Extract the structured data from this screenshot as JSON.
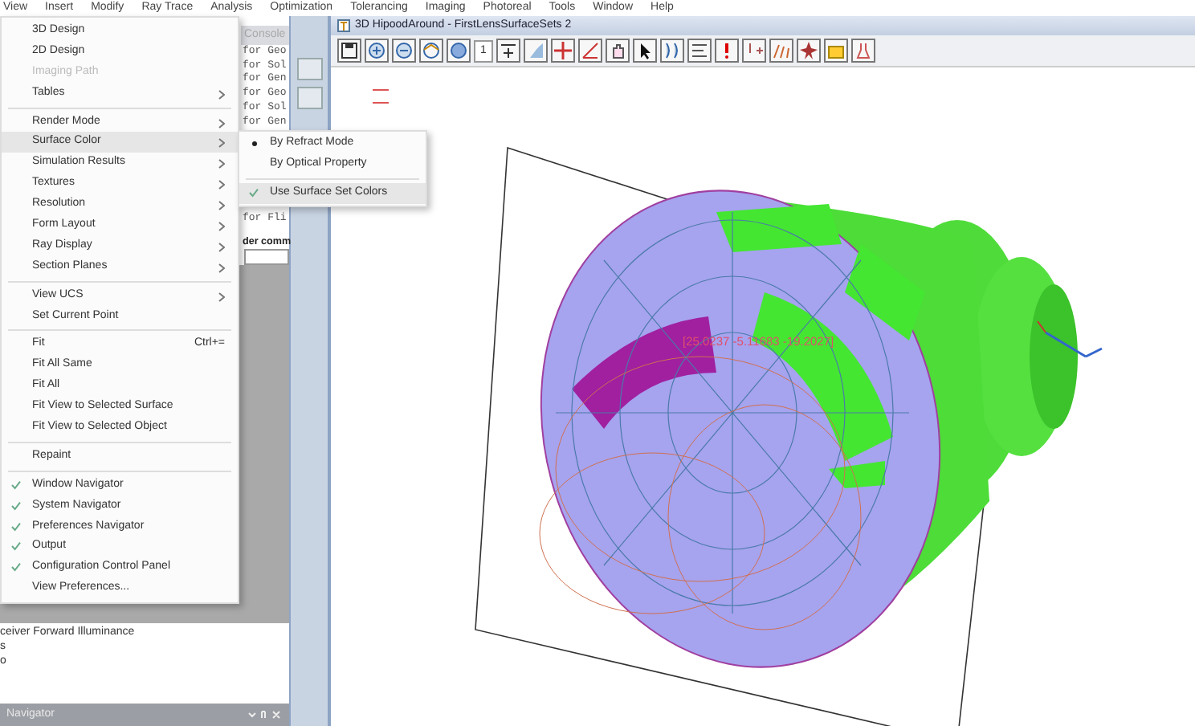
{
  "menu_bar": [
    "View",
    "Insert",
    "Modify",
    "Ray Trace",
    "Analysis",
    "Optimization",
    "Tolerancing",
    "Imaging",
    "Photoreal",
    "Tools",
    "Window",
    "Help"
  ],
  "view_menu": [
    {
      "kind": "item",
      "label": "3D Design"
    },
    {
      "kind": "item",
      "label": "2D Design"
    },
    {
      "kind": "item",
      "label": "Imaging Path",
      "disabled": true
    },
    {
      "kind": "item",
      "label": "Tables",
      "submenu": true
    },
    {
      "kind": "separator"
    },
    {
      "kind": "item",
      "label": "Render Mode",
      "submenu": true
    },
    {
      "kind": "item",
      "label": "Surface Color",
      "submenu": true,
      "selected": true
    },
    {
      "kind": "item",
      "label": "Simulation Results",
      "submenu": true
    },
    {
      "kind": "item",
      "label": "Textures",
      "submenu": true
    },
    {
      "kind": "item",
      "label": "Resolution",
      "submenu": true
    },
    {
      "kind": "item",
      "label": "Form Layout",
      "submenu": true
    },
    {
      "kind": "item",
      "label": "Ray Display",
      "submenu": true
    },
    {
      "kind": "item",
      "label": "Section Planes",
      "submenu": true
    },
    {
      "kind": "separator"
    },
    {
      "kind": "item",
      "label": "View UCS",
      "submenu": true
    },
    {
      "kind": "item",
      "label": "Set Current Point"
    },
    {
      "kind": "separator"
    },
    {
      "kind": "item",
      "label": "Fit",
      "shortcut": "Ctrl+="
    },
    {
      "kind": "item",
      "label": "Fit All Same"
    },
    {
      "kind": "item",
      "label": "Fit All"
    },
    {
      "kind": "item",
      "label": "Fit View to Selected Surface"
    },
    {
      "kind": "item",
      "label": "Fit View to Selected Object"
    },
    {
      "kind": "separator"
    },
    {
      "kind": "item",
      "label": "Repaint"
    },
    {
      "kind": "separator"
    },
    {
      "kind": "item",
      "label": "Window Navigator",
      "checked": true
    },
    {
      "kind": "item",
      "label": "System Navigator",
      "checked": true
    },
    {
      "kind": "item",
      "label": "Preferences Navigator",
      "checked": true
    },
    {
      "kind": "item",
      "label": "Output",
      "checked": true
    },
    {
      "kind": "item",
      "label": "Configuration Control Panel",
      "checked": true
    },
    {
      "kind": "item",
      "label": "View Preferences..."
    }
  ],
  "surface_color_menu": [
    {
      "kind": "radio",
      "label": "By Refract Mode",
      "checked": true,
      "selected": false
    },
    {
      "kind": "radio",
      "label": "By Optical Property",
      "checked": false,
      "selected": false
    },
    {
      "kind": "separator"
    },
    {
      "kind": "check",
      "label": "Use Surface Set Colors",
      "checked": true,
      "selected": true
    }
  ],
  "console": {
    "title": "Console",
    "lines": [
      "for Geo",
      "for Sol",
      "for Gen",
      "for Geo",
      "for Sol",
      "for Gen",
      "for Fli"
    ],
    "command_label": "der comm"
  },
  "navigator": {
    "lines": [
      "ceiver Forward Illuminance",
      "s",
      "o"
    ],
    "title": "Navigator"
  },
  "view_window": {
    "title": "3D HipoodAround - FirstLensSurfaceSets 2",
    "toolbar_field": "1",
    "coordinates": "[25.0237 -5.11683 -19.2027]"
  }
}
